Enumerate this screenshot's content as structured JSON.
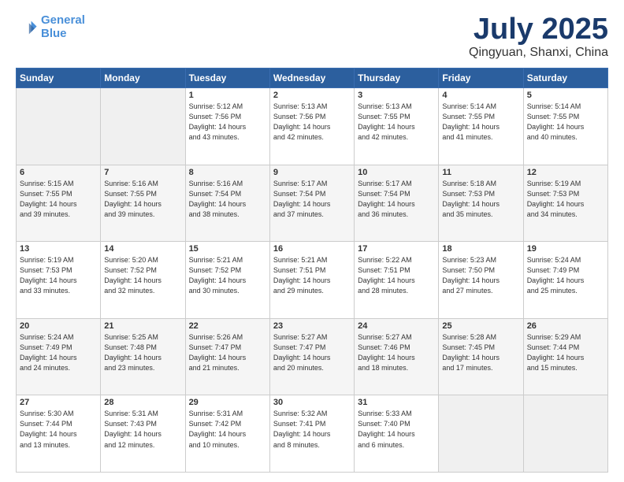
{
  "header": {
    "logo_line1": "General",
    "logo_line2": "Blue",
    "month": "July 2025",
    "location": "Qingyuan, Shanxi, China"
  },
  "weekdays": [
    "Sunday",
    "Monday",
    "Tuesday",
    "Wednesday",
    "Thursday",
    "Friday",
    "Saturday"
  ],
  "weeks": [
    [
      {
        "day": "",
        "info": ""
      },
      {
        "day": "",
        "info": ""
      },
      {
        "day": "1",
        "info": "Sunrise: 5:12 AM\nSunset: 7:56 PM\nDaylight: 14 hours\nand 43 minutes."
      },
      {
        "day": "2",
        "info": "Sunrise: 5:13 AM\nSunset: 7:56 PM\nDaylight: 14 hours\nand 42 minutes."
      },
      {
        "day": "3",
        "info": "Sunrise: 5:13 AM\nSunset: 7:55 PM\nDaylight: 14 hours\nand 42 minutes."
      },
      {
        "day": "4",
        "info": "Sunrise: 5:14 AM\nSunset: 7:55 PM\nDaylight: 14 hours\nand 41 minutes."
      },
      {
        "day": "5",
        "info": "Sunrise: 5:14 AM\nSunset: 7:55 PM\nDaylight: 14 hours\nand 40 minutes."
      }
    ],
    [
      {
        "day": "6",
        "info": "Sunrise: 5:15 AM\nSunset: 7:55 PM\nDaylight: 14 hours\nand 39 minutes."
      },
      {
        "day": "7",
        "info": "Sunrise: 5:16 AM\nSunset: 7:55 PM\nDaylight: 14 hours\nand 39 minutes."
      },
      {
        "day": "8",
        "info": "Sunrise: 5:16 AM\nSunset: 7:54 PM\nDaylight: 14 hours\nand 38 minutes."
      },
      {
        "day": "9",
        "info": "Sunrise: 5:17 AM\nSunset: 7:54 PM\nDaylight: 14 hours\nand 37 minutes."
      },
      {
        "day": "10",
        "info": "Sunrise: 5:17 AM\nSunset: 7:54 PM\nDaylight: 14 hours\nand 36 minutes."
      },
      {
        "day": "11",
        "info": "Sunrise: 5:18 AM\nSunset: 7:53 PM\nDaylight: 14 hours\nand 35 minutes."
      },
      {
        "day": "12",
        "info": "Sunrise: 5:19 AM\nSunset: 7:53 PM\nDaylight: 14 hours\nand 34 minutes."
      }
    ],
    [
      {
        "day": "13",
        "info": "Sunrise: 5:19 AM\nSunset: 7:53 PM\nDaylight: 14 hours\nand 33 minutes."
      },
      {
        "day": "14",
        "info": "Sunrise: 5:20 AM\nSunset: 7:52 PM\nDaylight: 14 hours\nand 32 minutes."
      },
      {
        "day": "15",
        "info": "Sunrise: 5:21 AM\nSunset: 7:52 PM\nDaylight: 14 hours\nand 30 minutes."
      },
      {
        "day": "16",
        "info": "Sunrise: 5:21 AM\nSunset: 7:51 PM\nDaylight: 14 hours\nand 29 minutes."
      },
      {
        "day": "17",
        "info": "Sunrise: 5:22 AM\nSunset: 7:51 PM\nDaylight: 14 hours\nand 28 minutes."
      },
      {
        "day": "18",
        "info": "Sunrise: 5:23 AM\nSunset: 7:50 PM\nDaylight: 14 hours\nand 27 minutes."
      },
      {
        "day": "19",
        "info": "Sunrise: 5:24 AM\nSunset: 7:49 PM\nDaylight: 14 hours\nand 25 minutes."
      }
    ],
    [
      {
        "day": "20",
        "info": "Sunrise: 5:24 AM\nSunset: 7:49 PM\nDaylight: 14 hours\nand 24 minutes."
      },
      {
        "day": "21",
        "info": "Sunrise: 5:25 AM\nSunset: 7:48 PM\nDaylight: 14 hours\nand 23 minutes."
      },
      {
        "day": "22",
        "info": "Sunrise: 5:26 AM\nSunset: 7:47 PM\nDaylight: 14 hours\nand 21 minutes."
      },
      {
        "day": "23",
        "info": "Sunrise: 5:27 AM\nSunset: 7:47 PM\nDaylight: 14 hours\nand 20 minutes."
      },
      {
        "day": "24",
        "info": "Sunrise: 5:27 AM\nSunset: 7:46 PM\nDaylight: 14 hours\nand 18 minutes."
      },
      {
        "day": "25",
        "info": "Sunrise: 5:28 AM\nSunset: 7:45 PM\nDaylight: 14 hours\nand 17 minutes."
      },
      {
        "day": "26",
        "info": "Sunrise: 5:29 AM\nSunset: 7:44 PM\nDaylight: 14 hours\nand 15 minutes."
      }
    ],
    [
      {
        "day": "27",
        "info": "Sunrise: 5:30 AM\nSunset: 7:44 PM\nDaylight: 14 hours\nand 13 minutes."
      },
      {
        "day": "28",
        "info": "Sunrise: 5:31 AM\nSunset: 7:43 PM\nDaylight: 14 hours\nand 12 minutes."
      },
      {
        "day": "29",
        "info": "Sunrise: 5:31 AM\nSunset: 7:42 PM\nDaylight: 14 hours\nand 10 minutes."
      },
      {
        "day": "30",
        "info": "Sunrise: 5:32 AM\nSunset: 7:41 PM\nDaylight: 14 hours\nand 8 minutes."
      },
      {
        "day": "31",
        "info": "Sunrise: 5:33 AM\nSunset: 7:40 PM\nDaylight: 14 hours\nand 6 minutes."
      },
      {
        "day": "",
        "info": ""
      },
      {
        "day": "",
        "info": ""
      }
    ]
  ]
}
